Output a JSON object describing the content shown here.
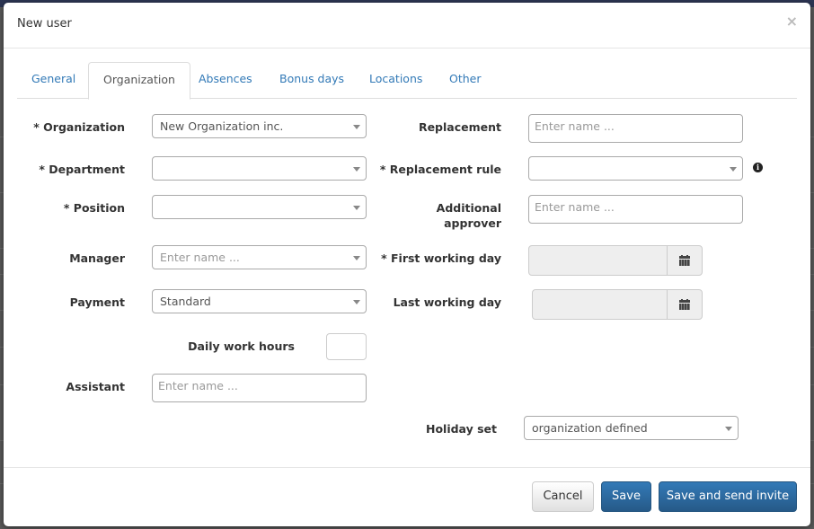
{
  "modal": {
    "title": "New user",
    "close_icon": "×"
  },
  "tabs": [
    {
      "label": "General",
      "active": false
    },
    {
      "label": "Organization",
      "active": true
    },
    {
      "label": "Absences",
      "active": false
    },
    {
      "label": "Bonus days",
      "active": false
    },
    {
      "label": "Locations",
      "active": false
    },
    {
      "label": "Other",
      "active": false
    }
  ],
  "form": {
    "organization": {
      "label": "* Organization",
      "value": "New Organization inc."
    },
    "department": {
      "label": "* Department",
      "value": ""
    },
    "position": {
      "label": "* Position",
      "value": ""
    },
    "manager": {
      "label": "Manager",
      "placeholder": "Enter name ..."
    },
    "payment": {
      "label": "Payment",
      "value": "Standard"
    },
    "daily_work_hours": {
      "label": "Daily work hours",
      "value": ""
    },
    "assistant": {
      "label": "Assistant",
      "placeholder": "Enter name ..."
    },
    "replacement": {
      "label": "Replacement",
      "placeholder": "Enter name ..."
    },
    "replacement_rule": {
      "label": "* Replacement rule",
      "value": "",
      "info_icon": "i"
    },
    "additional_approver": {
      "label_line1": "Additional",
      "label_line2": "approver",
      "placeholder": "Enter name ..."
    },
    "first_working_day": {
      "label": "* First working day",
      "value": ""
    },
    "last_working_day": {
      "label": "Last working day",
      "value": ""
    },
    "holiday_set": {
      "label": "Holiday set",
      "value": "organization defined"
    }
  },
  "footer": {
    "cancel_label": "Cancel",
    "save_label": "Save",
    "save_invite_label": "Save and send invite"
  }
}
